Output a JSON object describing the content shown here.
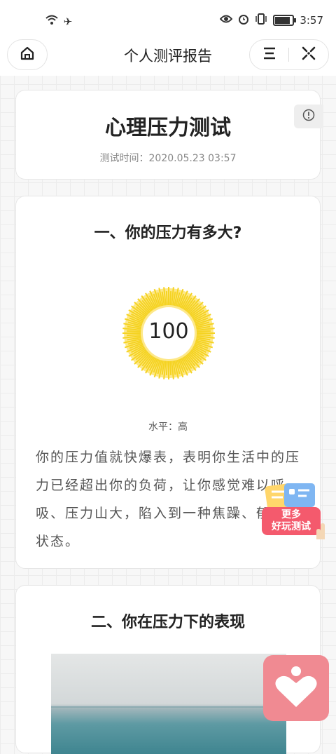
{
  "status_bar": {
    "icons_left": [
      "wifi-icon",
      "airplane-icon"
    ],
    "icons_right": [
      "eye-icon",
      "alarm-icon",
      "vibrate-icon",
      "battery-icon"
    ],
    "time": "3:57"
  },
  "nav": {
    "title": "个人测评报告",
    "home_icon": "home-icon",
    "menu_icon": "menu-icon",
    "close_icon": "close-icon"
  },
  "header_card": {
    "title": "心理压力测试",
    "time_label": "测试时间：",
    "time_value": "2020.05.23 03:57",
    "info_icon": "info-icon"
  },
  "section1": {
    "title": "一、你的压力有多大?",
    "score": "100",
    "level_label": "水平：",
    "level_value": "高",
    "description": "你的压力值就快爆表，表明你生活中的压力已经超出你的负荷，让你感觉难以呼吸、压力山大，陷入到一种焦躁、郁闷的状态。",
    "gauge_color": "#f5d322"
  },
  "section2": {
    "title": "二、你在压力下的表现"
  },
  "floating": {
    "more_line1": "更多",
    "more_line2": "好玩测试",
    "heart_icon": "heart-icon",
    "heart_bg": "#f08a92"
  }
}
